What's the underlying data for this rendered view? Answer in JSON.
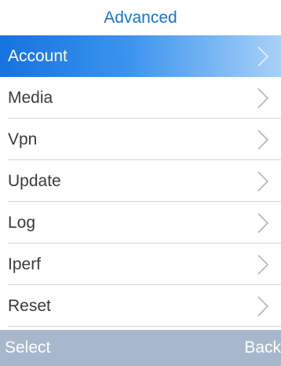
{
  "header": {
    "title": "Advanced"
  },
  "menu": {
    "items": [
      {
        "label": "Account",
        "selected": true
      },
      {
        "label": "Media",
        "selected": false
      },
      {
        "label": "Vpn",
        "selected": false
      },
      {
        "label": "Update",
        "selected": false
      },
      {
        "label": "Log",
        "selected": false
      },
      {
        "label": "Iperf",
        "selected": false
      },
      {
        "label": "Reset",
        "selected": false
      }
    ],
    "icon": "chevron-right-icon"
  },
  "softkeys": {
    "left": "Select",
    "right": "Back"
  },
  "colors": {
    "title": "#1a73c8",
    "selection_start": "#1673df",
    "selection_end": "#a9d1f8",
    "softkey_bar": "#a8b8cc",
    "item_text": "#3a3a3a",
    "divider": "#d4d4d4",
    "chevron": "#b5b5b5"
  }
}
